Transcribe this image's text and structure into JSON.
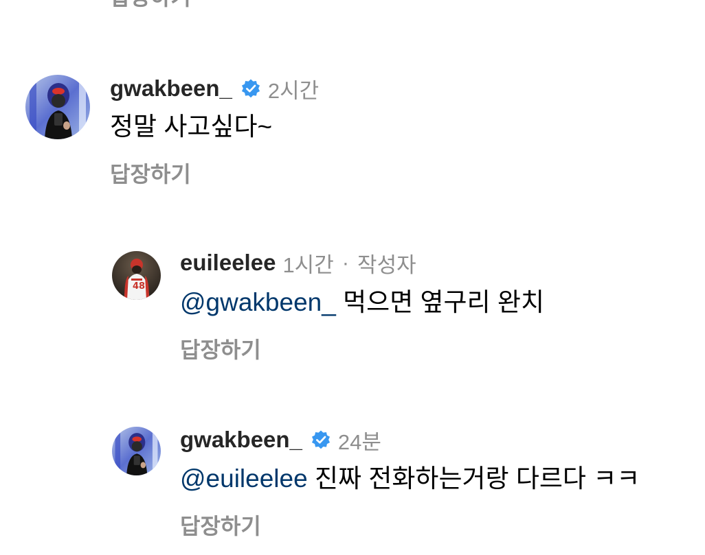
{
  "top_reply_label": "답장하기",
  "comments": [
    {
      "username": "gwakbeen_",
      "verified": true,
      "time": "2시간",
      "text": "정말 사고싶다~",
      "reply_label": "답장하기"
    },
    {
      "username": "euileelee",
      "verified": false,
      "time": "1시간",
      "separator": "·",
      "author_tag": "작성자",
      "mention": "@gwakbeen_",
      "text": "먹으면 옆구리 완치",
      "reply_label": "답장하기"
    },
    {
      "username": "gwakbeen_",
      "verified": true,
      "time": "24분",
      "mention": "@euileelee",
      "text": "진짜 전화하는거랑 다르다 ㅋㅋ",
      "reply_label": "답장하기"
    }
  ],
  "colors": {
    "verified_badge": "#3897f0",
    "mention": "#00376b",
    "secondary_text": "#8e8e8e",
    "username": "#262626"
  },
  "icons": {
    "verified": "verified-badge-icon",
    "avatar_gwakbeen": "avatar-gwakbeen",
    "avatar_euileelee": "avatar-euileelee"
  }
}
